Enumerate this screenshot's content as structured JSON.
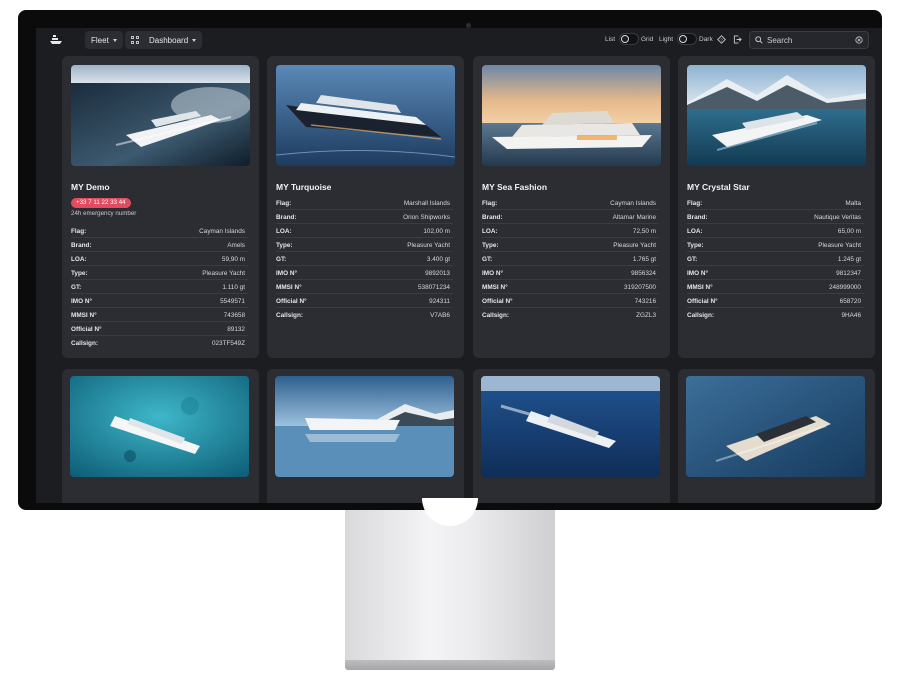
{
  "toolbar": {
    "fleet_label": "Fleet",
    "dashboard_label": "Dashboard",
    "list_label": "List",
    "grid_label": "Grid",
    "light_label": "Light",
    "dark_label": "Dark",
    "search_placeholder": "Search"
  },
  "labels": {
    "flag": "Flag:",
    "brand": "Brand:",
    "loa": "LOA:",
    "type": "Type:",
    "gt": "GT:",
    "imo": "IMO N°",
    "mmsi": "MMSI N°",
    "official": "Official N°",
    "callsign": "Callsign:"
  },
  "yachts": [
    {
      "name": "MY Demo",
      "emergency_phone": "+33 7 11 22 33 44",
      "emergency_label": "24h emergency number",
      "flag": "Cayman Islands",
      "brand": "Amels",
      "loa": "59,90 m",
      "type": "Pleasure Yacht",
      "gt": "1.110 gt",
      "imo": "5549571",
      "mmsi": "743658",
      "official": "89132",
      "callsign": "023TF549Z"
    },
    {
      "name": "MY Turquoise",
      "flag": "Marshall Islands",
      "brand": "Orion Shipworks",
      "loa": "102,00 m",
      "type": "Pleasure Yacht",
      "gt": "3.400 gt",
      "imo": "9892013",
      "mmsi": "538071234",
      "official": "924311",
      "callsign": "V7AB6"
    },
    {
      "name": "MY Sea Fashion",
      "flag": "Cayman Islands",
      "brand": "Altamar Marine",
      "loa": "72,50 m",
      "type": "Pleasure Yacht",
      "gt": "1.765 gt",
      "imo": "9856324",
      "mmsi": "319207500",
      "official": "743216",
      "callsign": "ZGZL3"
    },
    {
      "name": "MY Crystal Star",
      "flag": "Malta",
      "brand": "Nautique Veritas",
      "loa": "65,00 m",
      "type": "Pleasure Yacht",
      "gt": "1.245 gt",
      "imo": "9812347",
      "mmsi": "248999000",
      "official": "658720",
      "callsign": "9HA46"
    }
  ],
  "colors": {
    "badge": "#e44b60",
    "card": "#2b2d33",
    "background": "#1c1d21"
  },
  "icons": [
    "ship-logo-icon",
    "chevron-down-icon",
    "grid-icon",
    "help-icon",
    "logout-icon",
    "search-icon",
    "clear-icon"
  ]
}
